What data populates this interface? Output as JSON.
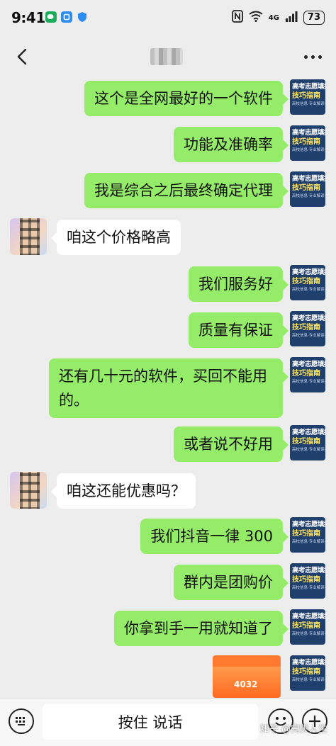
{
  "status": {
    "time": "9:41",
    "network": "4G",
    "battery": "73"
  },
  "nav": {
    "contact_name": ""
  },
  "my_avatar": {
    "line1": "高考志愿填报",
    "line2": "技巧指南",
    "line3": "高校信息·专业解读·志愿规划"
  },
  "messages": [
    {
      "from": "me",
      "text": "这个是全网最好的一个软件"
    },
    {
      "from": "me",
      "text": "功能及准确率"
    },
    {
      "from": "me",
      "text": "我是综合之后最终确定代理"
    },
    {
      "from": "them",
      "text": "咱这个价格略高"
    },
    {
      "from": "me",
      "text": "我们服务好"
    },
    {
      "from": "me",
      "text": "质量有保证"
    },
    {
      "from": "me",
      "text": "还有几十元的软件，买回不能用的。"
    },
    {
      "from": "me",
      "text": "或者说不好用"
    },
    {
      "from": "them",
      "text": "咱这还能优惠吗？"
    },
    {
      "from": "me",
      "text": "我们抖音一律 300"
    },
    {
      "from": "me",
      "text": "群内是团购价"
    },
    {
      "from": "me",
      "text": "你拿到手一用就知道了"
    }
  ],
  "image_message": {
    "caption": "4032"
  },
  "bottom": {
    "hold_to_talk": "按住 说话"
  },
  "watermark": "知乎 @完美人生",
  "colors": {
    "chat_background": "#ededed",
    "my_bubble": "#95ec69",
    "their_bubble": "#ffffff",
    "avatar_bg": "#1f3f6d",
    "avatar_accent": "#ffe766"
  }
}
